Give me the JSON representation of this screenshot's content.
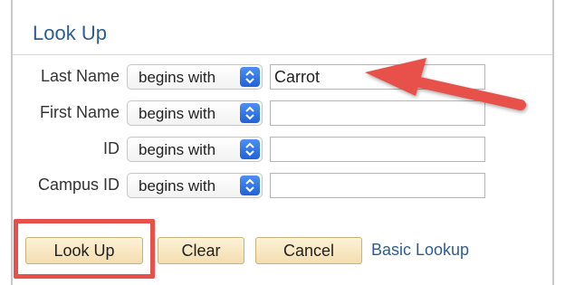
{
  "dialog": {
    "title": "Look Up"
  },
  "fields": [
    {
      "label": "Last Name",
      "operator": "begins with",
      "value": "Carrot"
    },
    {
      "label": "First Name",
      "operator": "begins with",
      "value": ""
    },
    {
      "label": "ID",
      "operator": "begins with",
      "value": ""
    },
    {
      "label": "Campus ID",
      "operator": "begins with",
      "value": ""
    }
  ],
  "buttons": {
    "lookup": "Look Up",
    "clear": "Clear",
    "cancel": "Cancel",
    "basic_lookup": "Basic Lookup"
  },
  "annotations": {
    "highlight_color": "#e8504a",
    "arrow_color": "#e8504a"
  },
  "icons": {
    "stepper": "select-stepper-icon",
    "arrow": "red-arrow-annotation"
  }
}
